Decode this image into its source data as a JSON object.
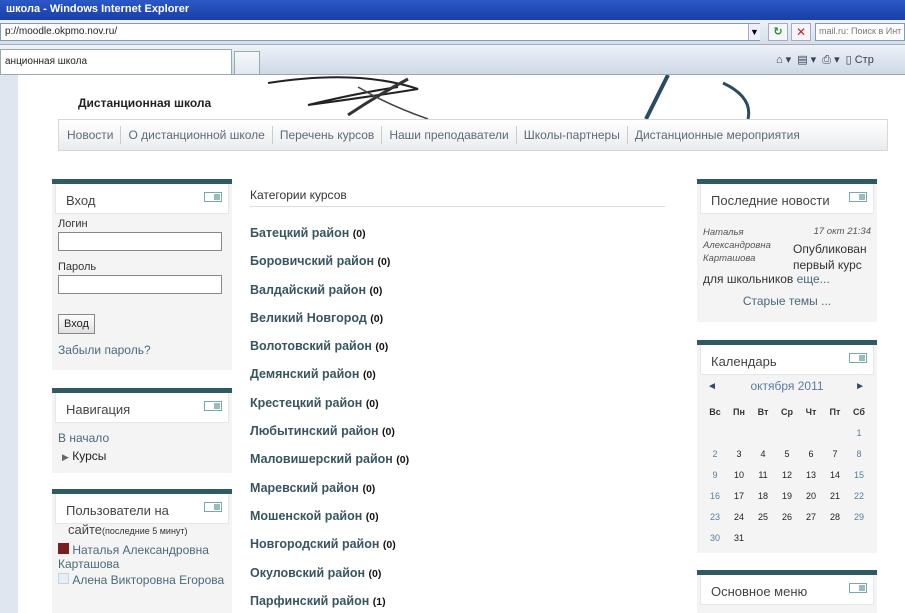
{
  "browser": {
    "title": "школа - Windows Internet Explorer",
    "address": "p://moodle.okpmo.nov.ru/",
    "search_placeholder": "mail.ru: Поиск в Инт",
    "tab_label": "анционная школа",
    "tools_page": "Стр"
  },
  "site": {
    "name": "Дистанционная школа",
    "nav": [
      "Новости",
      "О дистанционной школе",
      "Перечень курсов",
      "Наши преподаватели",
      "Школы-партнеры",
      "Дистанционные мероприятия"
    ]
  },
  "login": {
    "title": "Вход",
    "login_label": "Логин",
    "password_label": "Пароль",
    "button": "Вход",
    "forgot": "Забыли пароль?"
  },
  "navigation": {
    "title": "Навигация",
    "home": "В начало",
    "courses": "Курсы"
  },
  "users": {
    "title_line1": "Пользователи на",
    "title_line2": "сайте",
    "period": "(последние 5 минут)",
    "list": [
      "Наталья Александровна Карташова",
      "Алена Викторовна Егорова"
    ]
  },
  "main": {
    "title": "Категории курсов",
    "categories": [
      {
        "name": "Батецкий район",
        "count": "(0)"
      },
      {
        "name": "Боровичский район",
        "count": "(0)"
      },
      {
        "name": "Валдайский район",
        "count": "(0)"
      },
      {
        "name": "Великий Новгород",
        "count": "(0)"
      },
      {
        "name": "Волотовский район",
        "count": "(0)"
      },
      {
        "name": "Демянский район",
        "count": "(0)"
      },
      {
        "name": "Крестецкий район",
        "count": "(0)"
      },
      {
        "name": "Любытинский район",
        "count": "(0)"
      },
      {
        "name": "Маловишерский район",
        "count": "(0)"
      },
      {
        "name": "Маревский район",
        "count": "(0)"
      },
      {
        "name": "Мошенской район",
        "count": "(0)"
      },
      {
        "name": "Новгородский район",
        "count": "(0)"
      },
      {
        "name": "Окуловский район",
        "count": "(0)"
      },
      {
        "name": "Парфинский район",
        "count": "(1)"
      }
    ]
  },
  "news": {
    "title": "Последние новости",
    "author_line1": "Наталья",
    "author_line2": "Александровна",
    "author_line3": "Карташова",
    "date": "17 окт 21:34",
    "text1": "Опубликован",
    "text2": "первый курс",
    "text3": "для школьников",
    "more": "еще...",
    "old": "Старые темы ..."
  },
  "calendar": {
    "title": "Календарь",
    "month": "октября 2011",
    "prev": "◄",
    "next": "►",
    "days": [
      "Вс",
      "Пн",
      "Вт",
      "Ср",
      "Чт",
      "Пт",
      "Сб"
    ],
    "weeks": [
      [
        "",
        "",
        "",
        "",
        "",
        "",
        "1"
      ],
      [
        "2",
        "3",
        "4",
        "5",
        "6",
        "7",
        "8"
      ],
      [
        "9",
        "10",
        "11",
        "12",
        "13",
        "14",
        "15"
      ],
      [
        "16",
        "17",
        "18",
        "19",
        "20",
        "21",
        "22"
      ],
      [
        "23",
        "24",
        "25",
        "26",
        "27",
        "28",
        "29"
      ],
      [
        "30",
        "31",
        "",
        "",
        "",
        "",
        ""
      ]
    ]
  },
  "main_menu": {
    "title": "Основное меню"
  }
}
